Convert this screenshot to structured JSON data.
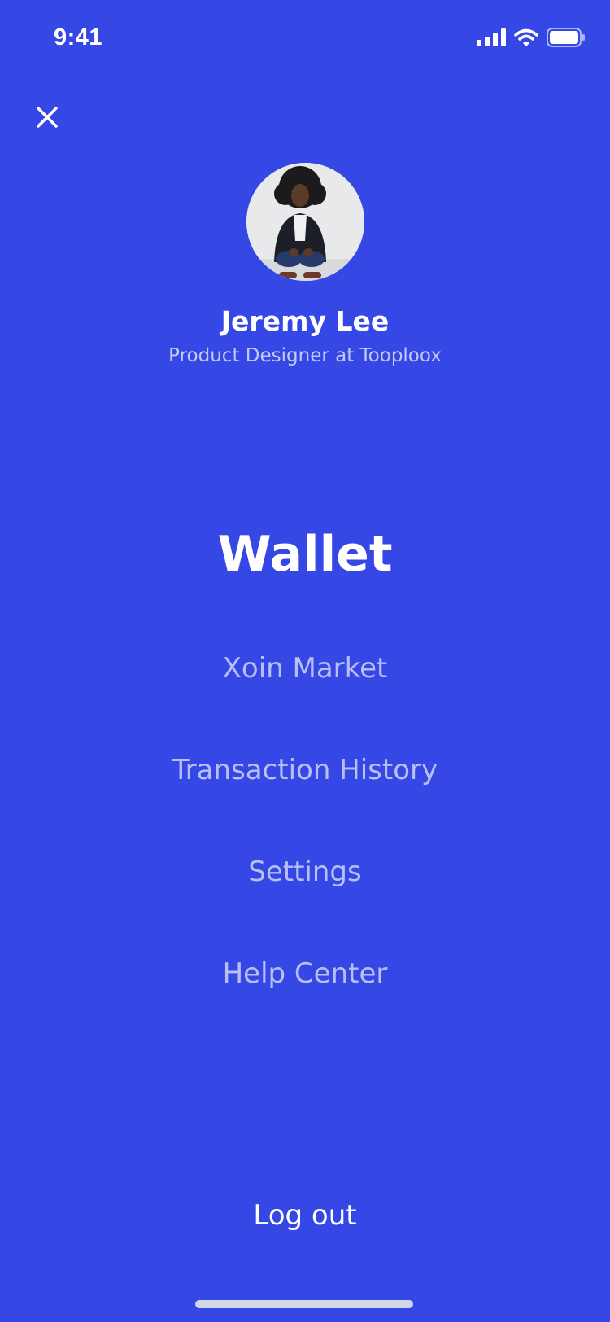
{
  "status_bar": {
    "time": "9:41",
    "icons": [
      "cellular-signal-icon",
      "wifi-icon",
      "battery-icon"
    ]
  },
  "header": {
    "close_icon": "close-icon"
  },
  "profile": {
    "name": "Jeremy Lee",
    "title": "Product Designer at Tooploox"
  },
  "menu": {
    "items": [
      {
        "label": "Wallet",
        "active": true
      },
      {
        "label": "Xoin Market",
        "active": false
      },
      {
        "label": "Transaction History",
        "active": false
      },
      {
        "label": "Settings",
        "active": false
      },
      {
        "label": "Help Center",
        "active": false
      }
    ],
    "logout_label": "Log out"
  },
  "colors": {
    "background": "#3547E4",
    "primary_text": "#FFFFFF",
    "secondary_text": "#B7BFF4"
  }
}
